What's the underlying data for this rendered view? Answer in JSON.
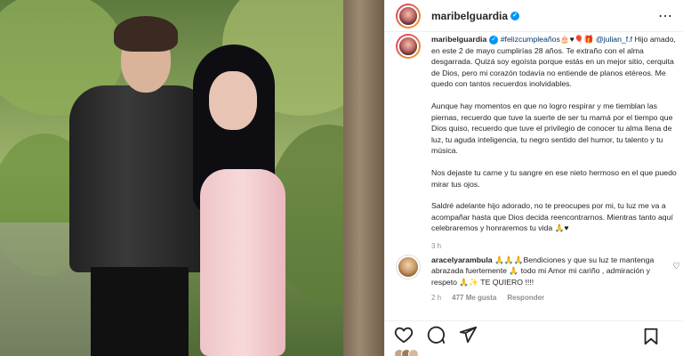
{
  "post": {
    "username": "maribelguardia",
    "caption_user": "maribelguardia",
    "caption_p1_hashtag": "#felizcumpleaños",
    "caption_p1_emojis": "🎂♥🎈🎁",
    "caption_p1_mention": "@julian_f.f",
    "caption_p1_rest": "Hijo amado, en este 2 de mayo cumplirías 28 años. Te extraño con el alma desgarrada. Quizá soy egoísta porque estás en un mejor sitio, cerquita de Dios, pero mi corazón todavía no entiende de planos etéreos. Me quedo con tantos recuerdos inolvidables.",
    "caption_p2": "Aunque hay momentos en que no logro respirar y me tiemblan las piernas, recuerdo que tuve la suerte de ser tu mamá por el tiempo que Dios quiso, recuerdo que tuve el privilegio de conocer tu alma llena de luz, tu aguda inteligencia, tu negro sentido del humor, tu talento y tu música.",
    "caption_p3": "Nos dejaste tu carne y tu sangre en ese nieto hermoso en el que puedo mirar tus ojos.",
    "caption_p4": "Saldré adelante hijo adorado, no te preocupes por mi, tu luz me va a acompañar hasta que Dios decida reencontrarnos. Mientras tanto aquí celebraremos y honraremos tu vida 🙏♥",
    "time_ago": "3 h"
  },
  "comment": {
    "username": "aracelyarambula",
    "text": "🙏🙏🙏Bendiciones y que su luz te mantenga abrazada fuertemente 🙏 todo mi Amor mi cariño , admiración y respeto 🙏✨ TE QUIERO !!!!",
    "time": "2 h",
    "likes": "477 Me gusta",
    "reply": "Responder"
  },
  "icons": {
    "more": "more-options-icon",
    "verified": "verified-badge-icon",
    "like": "heart-icon",
    "comment": "comment-icon",
    "share": "share-icon",
    "save": "bookmark-icon"
  },
  "colors": {
    "accent_link": "#00376b",
    "verified": "#0095f6",
    "muted": "#8e8e8e"
  }
}
